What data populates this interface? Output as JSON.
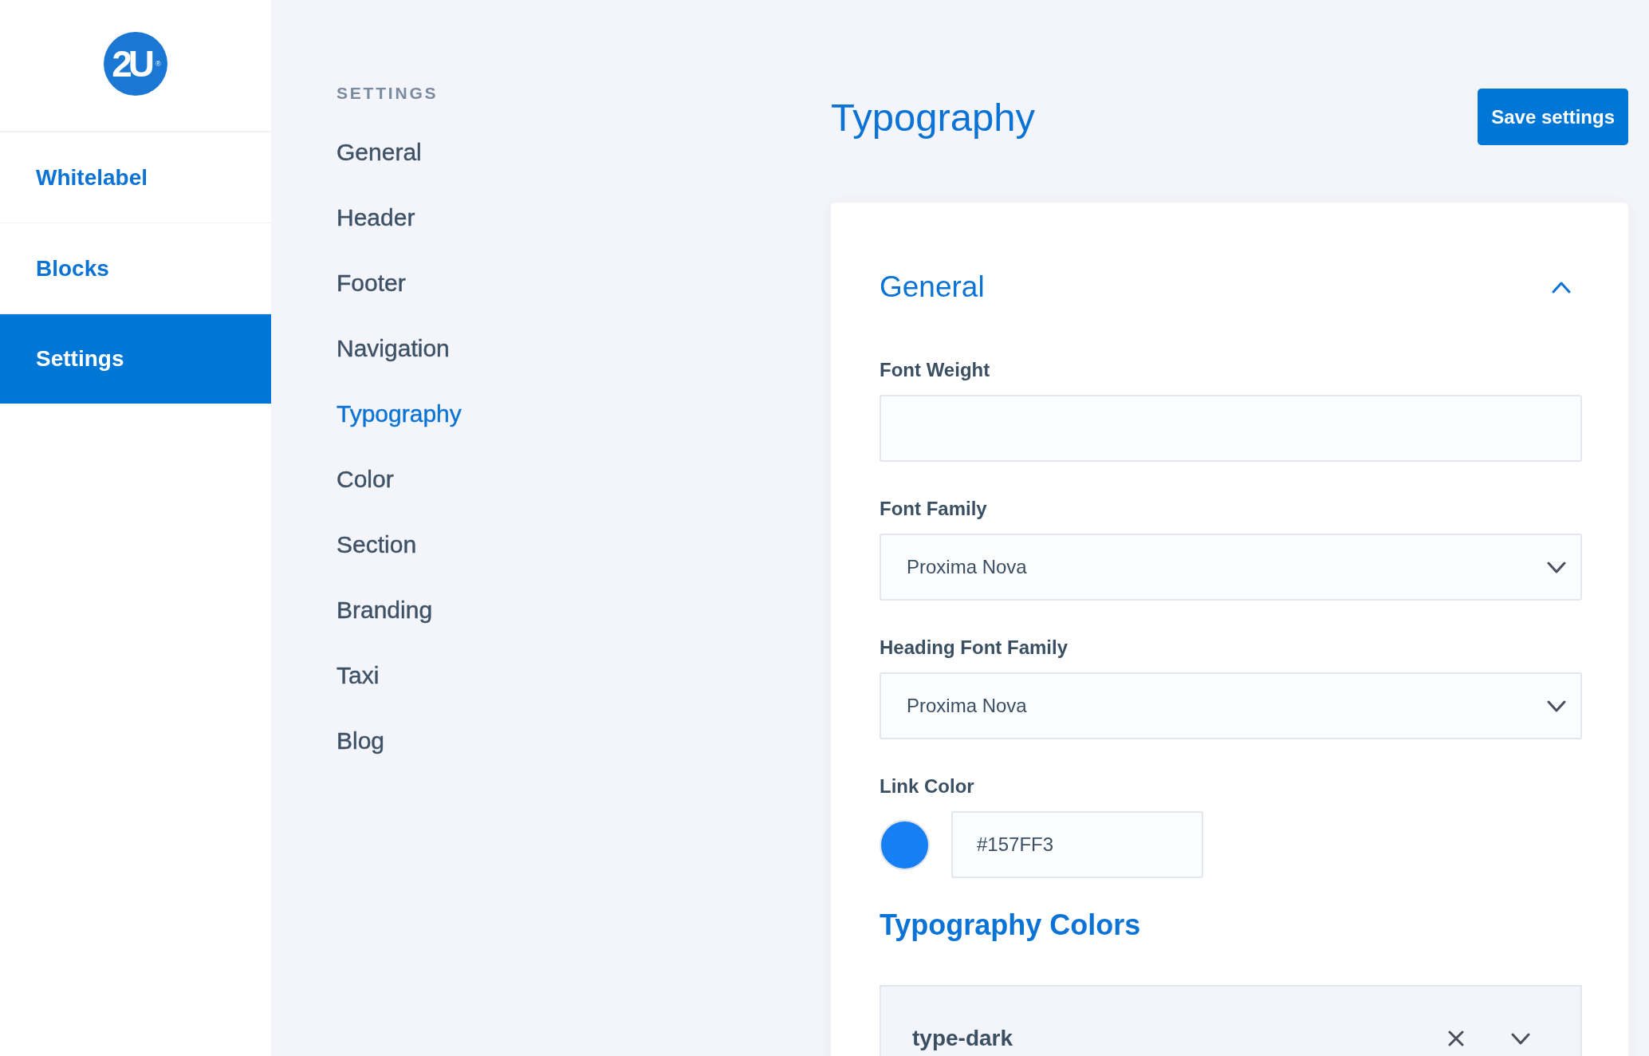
{
  "logo": {
    "text": "2U$^{®}$"
  },
  "sidebar": {
    "items": [
      {
        "label": "Whitelabel",
        "selected": false
      },
      {
        "label": "Blocks",
        "selected": false
      },
      {
        "label": "Settings",
        "selected": true
      }
    ]
  },
  "settings_nav": {
    "heading": "SETTINGS",
    "items": [
      {
        "label": "General",
        "selected": false
      },
      {
        "label": "Header",
        "selected": false
      },
      {
        "label": "Footer",
        "selected": false
      },
      {
        "label": "Navigation",
        "selected": false
      },
      {
        "label": "Typography",
        "selected": true
      },
      {
        "label": "Color",
        "selected": false
      },
      {
        "label": "Section",
        "selected": false
      },
      {
        "label": "Branding",
        "selected": false
      },
      {
        "label": "Taxi",
        "selected": false
      },
      {
        "label": "Blog",
        "selected": false
      }
    ]
  },
  "header": {
    "title": "Typography",
    "save_button": "Save settings"
  },
  "panel": {
    "title": "General",
    "expanded": true,
    "fields": [
      {
        "kind": "text",
        "label": "Font Weight"
      },
      {
        "kind": "select",
        "label": "Font Family",
        "value": "Proxima Nova"
      },
      {
        "kind": "select",
        "label": "Heading Font Family",
        "value": "Proxima Nova"
      },
      {
        "kind": "color",
        "label": "Link Color",
        "value": "#157FF3",
        "color": "#157ff3"
      }
    ],
    "typography_colors": {
      "title": "Typography Colors",
      "items": [
        {
          "name": "type-dark",
          "expanded": false
        }
      ]
    }
  }
}
